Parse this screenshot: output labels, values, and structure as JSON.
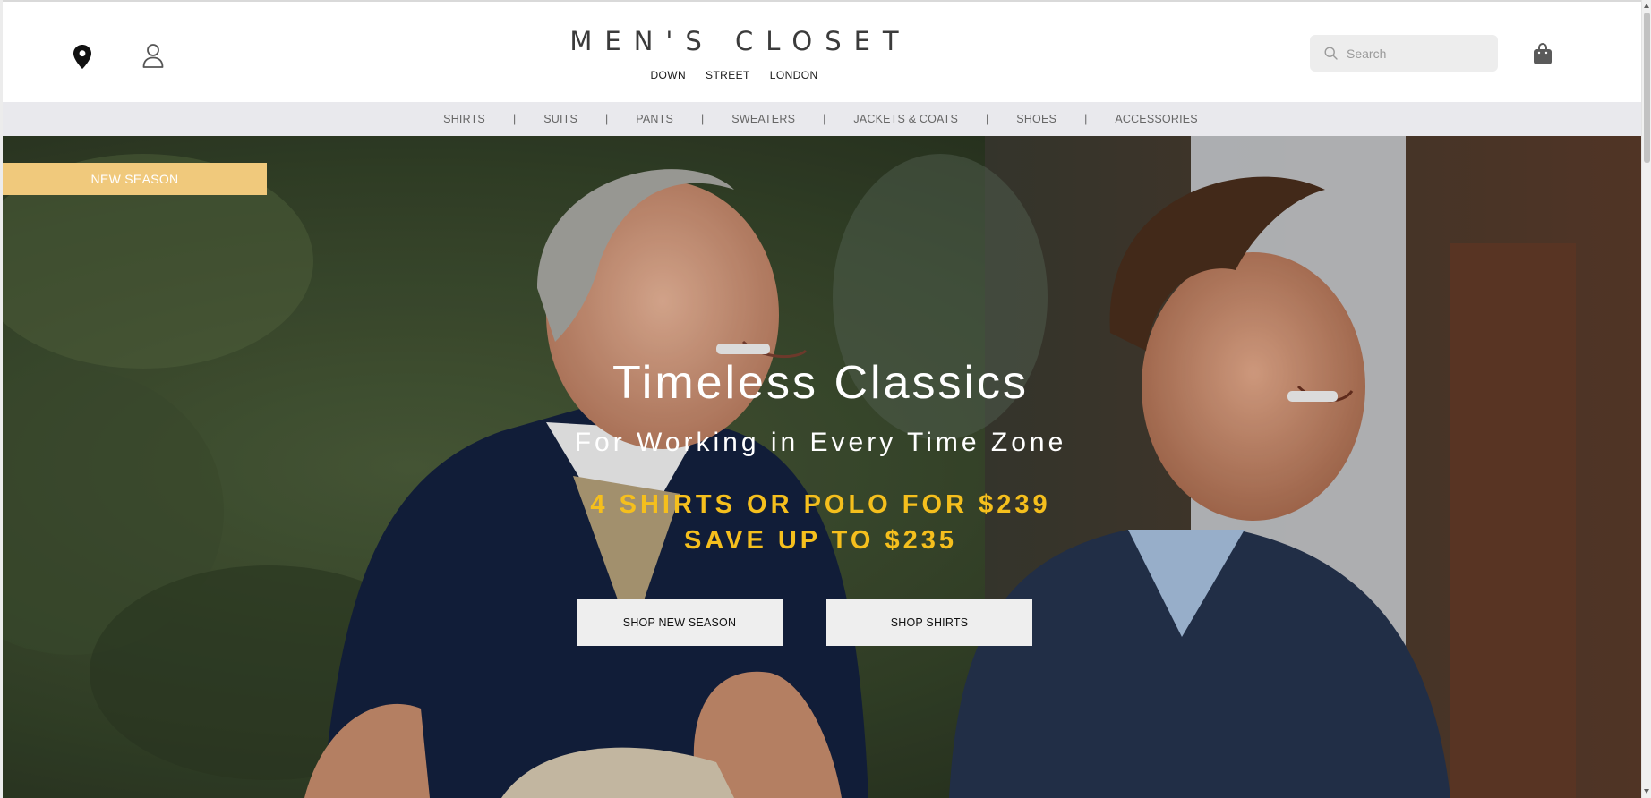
{
  "brand": {
    "name": "MEN'S CLOSET",
    "sub": [
      "DOWN",
      "STREET",
      "LONDON"
    ]
  },
  "header": {
    "icons": [
      "location-pin-icon",
      "user-icon",
      "search-icon",
      "shopping-bag-icon"
    ],
    "search_placeholder": "Search"
  },
  "nav": {
    "items": [
      "SHIRTS",
      "SUITS",
      "PANTS",
      "SWEATERS",
      "JACKETS & COATS",
      "SHOES",
      "ACCESSORIES"
    ],
    "separator": "|"
  },
  "hero": {
    "badge": "NEW SEASON",
    "headline": "Timeless Classics",
    "subline": "For Working in Every Time Zone",
    "promo_line1": "4 SHIRTS OR POLO FOR $239",
    "promo_line2": "SAVE UP TO $235",
    "buttons": [
      "SHOP NEW SEASON",
      "SHOP SHIRTS"
    ]
  },
  "colors": {
    "badge_bg": "#f0c97c",
    "promo_text": "#f5bf1d",
    "nav_bg": "#e9e9ed",
    "button_bg": "#eeeeee"
  }
}
